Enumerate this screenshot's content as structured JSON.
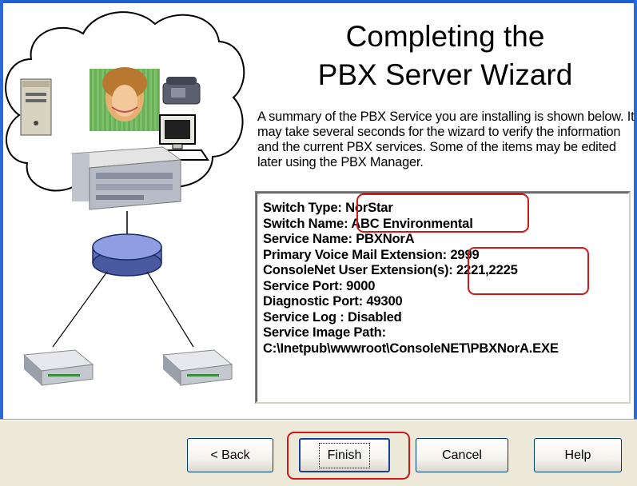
{
  "wizard": {
    "title_line1": "Completing the",
    "title_line2": "PBX Server Wizard",
    "description": "A summary of the PBX Service you are installing is shown below. It may take several seconds for the wizard to verify the information and the current PBX services.  Some of the items may be edited later using the PBX Manager."
  },
  "summary": {
    "lines": [
      "Switch Type: NorStar",
      "Switch Name: ABC Environmental",
      "Service Name: PBXNorA",
      "Primary Voice Mail Extension: 2999",
      "ConsoleNet User Extension(s): 2221,2225",
      "Service Port: 9000",
      "Diagnostic Port: 49300",
      "Service Log : Disabled",
      "Service Image Path:",
      "C:\\Inetpub\\wwwroot\\ConsoleNET\\PBXNorA.EXE"
    ]
  },
  "buttons": {
    "back": "< Back",
    "finish": "Finish",
    "cancel": "Cancel",
    "help": "Help"
  },
  "colors": {
    "highlight": "#d01818",
    "frame": "#1c5fd0"
  }
}
